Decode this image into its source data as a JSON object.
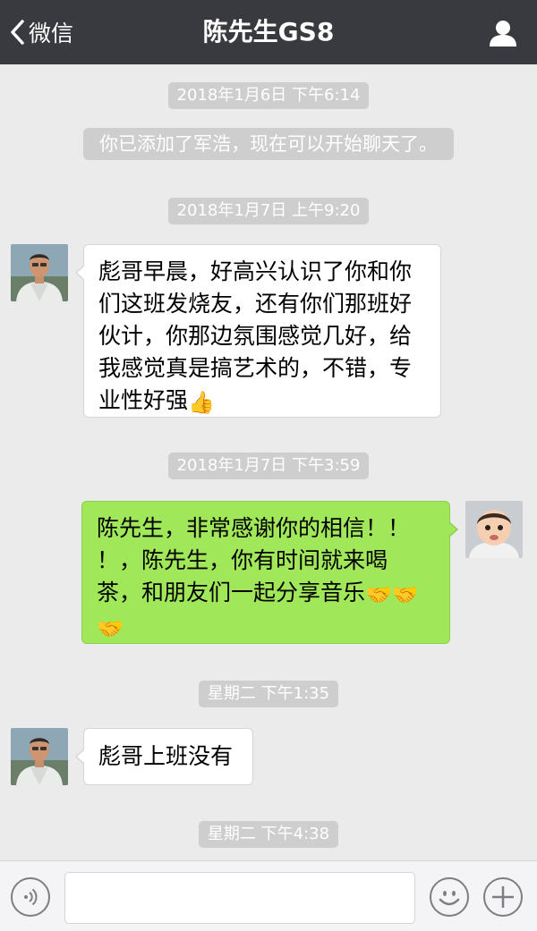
{
  "header": {
    "back_label": "微信",
    "title": "陈先生GS8"
  },
  "messages": {
    "ts1": "2018年1月6日 下午6:14",
    "system": "你已添加了军浩，现在可以开始聊天了。",
    "ts2": "2018年1月7日 上午9:20",
    "m1_l1": "彪哥早晨，好高兴认识了你和你",
    "m1_l2": "们这班发烧友，还有你们那班好",
    "m1_l3": "伙计，你那边氛围感觉几好，给",
    "m1_l4": "我感觉真是搞艺术的，不错，专",
    "m1_l5": "业性好强",
    "ts3": "2018年1月7日 下午3:59",
    "m2_l1": "陈先生，非常感谢你的相信！！",
    "m2_l2": "！，陈先生，你有时间就来喝",
    "m2_l3": "茶，和朋友们一起分享音乐",
    "ts4": "星期二 下午1:35",
    "m3": "彪哥上班没有",
    "ts5": "星期二 下午4:38"
  },
  "icons": {
    "thumbs_up": "👍",
    "handshake": "🤝"
  },
  "colors": {
    "header_bg": "#393a3f",
    "chat_bg": "#ebebeb",
    "sent_bubble": "#a0e75a",
    "received_bubble": "#ffffff",
    "timestamp_bg": "#cecece"
  }
}
